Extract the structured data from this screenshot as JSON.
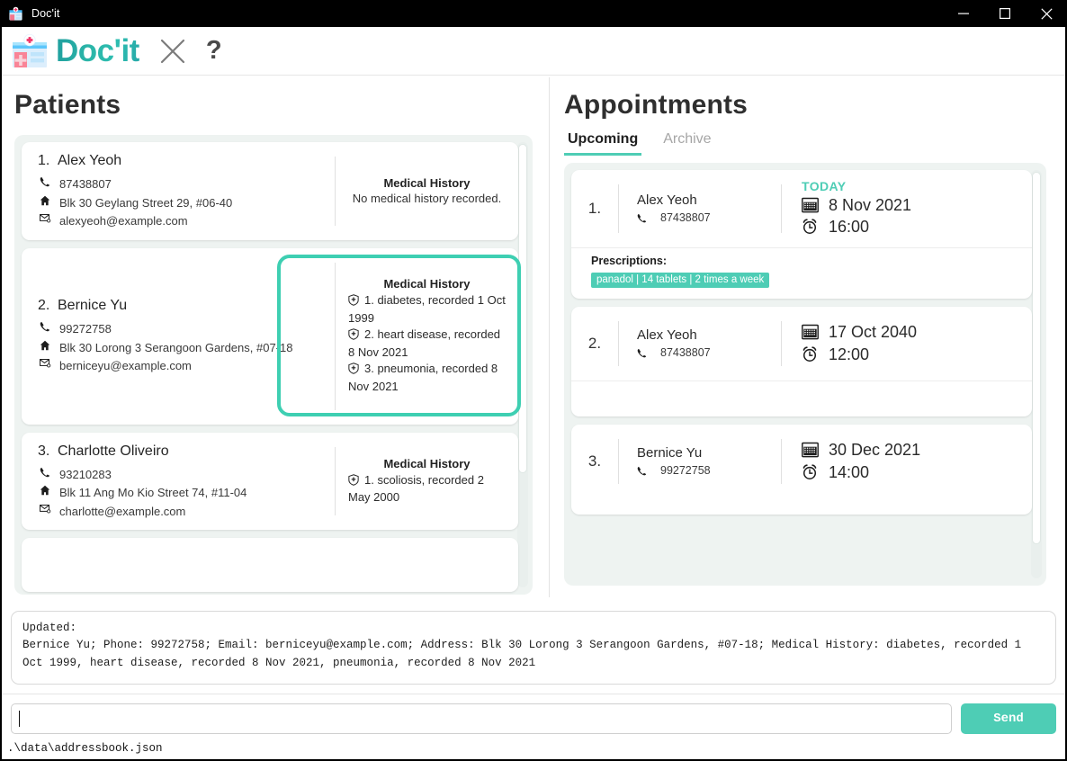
{
  "titlebar": {
    "title": "Doc'it",
    "app_icon": "clinic-icon",
    "minimize": "minimize-icon",
    "maximize": "maximize-icon",
    "close": "close-icon"
  },
  "header": {
    "logo_icon": "clinic-icon",
    "logo_text": "Doc'it",
    "exit_icon": "close-x-icon",
    "help_icon": "question-mark-icon"
  },
  "colors": {
    "accent": "#4ecdb5",
    "highlight": "#3ecfb2",
    "logo": "#23a7a2",
    "titlebar_bg": "#000000",
    "list_bg": "#eef3f1"
  },
  "patients_panel": {
    "title": "Patients",
    "items": [
      {
        "index": "1.",
        "name": "Alex Yeoh",
        "phone": "87438807",
        "address": "Blk 30 Geylang Street 29, #06-40",
        "email": "alexyeoh@example.com",
        "history_title": "Medical History",
        "history_empty": "No medical history recorded.",
        "history": []
      },
      {
        "index": "2.",
        "name": "Bernice Yu",
        "phone": "99272758",
        "address": "Blk 30 Lorong 3 Serangoon Gardens, #07-18",
        "email": "berniceyu@example.com",
        "history_title": "Medical History",
        "history_empty": "",
        "history": [
          "1. diabetes, recorded 1 Oct 1999",
          "2. heart disease, recorded 8 Nov 2021",
          "3. pneumonia, recorded 8 Nov 2021"
        ]
      },
      {
        "index": "3.",
        "name": "Charlotte Oliveiro",
        "phone": "93210283",
        "address": "Blk 11 Ang Mo Kio Street 74, #11-04",
        "email": "charlotte@example.com",
        "history_title": "Medical History",
        "history_empty": "",
        "history": [
          "1. scoliosis, recorded 2 May 2000"
        ]
      }
    ]
  },
  "appointments_panel": {
    "title": "Appointments",
    "tabs": [
      {
        "label": "Upcoming",
        "active": true
      },
      {
        "label": "Archive",
        "active": false
      }
    ],
    "items": [
      {
        "index": "1.",
        "patient": "Alex Yeoh",
        "phone": "87438807",
        "today_badge": "TODAY",
        "date": "8 Nov 2021",
        "time": "16:00",
        "prescriptions_label": "Prescriptions:",
        "prescriptions": [
          "panadol | 14 tablets | 2 times a week"
        ]
      },
      {
        "index": "2.",
        "patient": "Alex Yeoh",
        "phone": "87438807",
        "today_badge": "",
        "date": "17 Oct 2040",
        "time": "12:00",
        "prescriptions_label": "",
        "prescriptions": []
      },
      {
        "index": "3.",
        "patient": "Bernice Yu",
        "phone": "99272758",
        "today_badge": "",
        "date": "30 Dec 2021",
        "time": "14:00",
        "prescriptions_label": "",
        "prescriptions": []
      }
    ]
  },
  "console": {
    "result_text": "Updated:\nBernice Yu; Phone: 99272758; Email: berniceyu@example.com; Address: Blk 30 Lorong 3 Serangoon Gardens, #07-18; Medical History: diabetes, recorded 1 Oct 1999, heart disease, recorded 8 Nov 2021, pneumonia, recorded 8 Nov 2021",
    "command_value": "",
    "command_placeholder": "",
    "send_label": "Send",
    "status_path": ".\\data\\addressbook.json"
  }
}
